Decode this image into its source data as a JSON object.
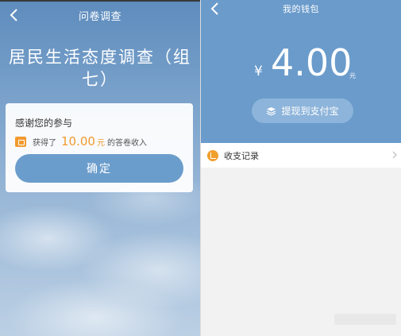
{
  "left_screen": {
    "nav": {
      "title": "问卷调查",
      "back_icon": "back-chevron-icon"
    },
    "survey_title_line1": "居民生活态度调查（组",
    "survey_title_line2": "七）",
    "dialog": {
      "thanks": "感谢您的参与",
      "reward_prefix": "获得了",
      "reward_amount": "10.00",
      "reward_unit": "元",
      "reward_suffix": "的答卷收入",
      "reward_icon": "wallet-icon",
      "confirm_label": "确定"
    }
  },
  "right_screen": {
    "nav": {
      "title": "我的钱包",
      "back_icon": "back-chevron-icon"
    },
    "currency_symbol": "¥",
    "balance": "4.00",
    "balance_unit": "元",
    "withdraw_label": "提现到支付宝",
    "withdraw_icon": "layers-icon",
    "records_label": "收支记录",
    "records_icon": "records-icon"
  },
  "colors": {
    "header_blue": "#6a9bcb",
    "button_blue": "#6b9dcc",
    "accent_orange": "#f29a2e"
  }
}
